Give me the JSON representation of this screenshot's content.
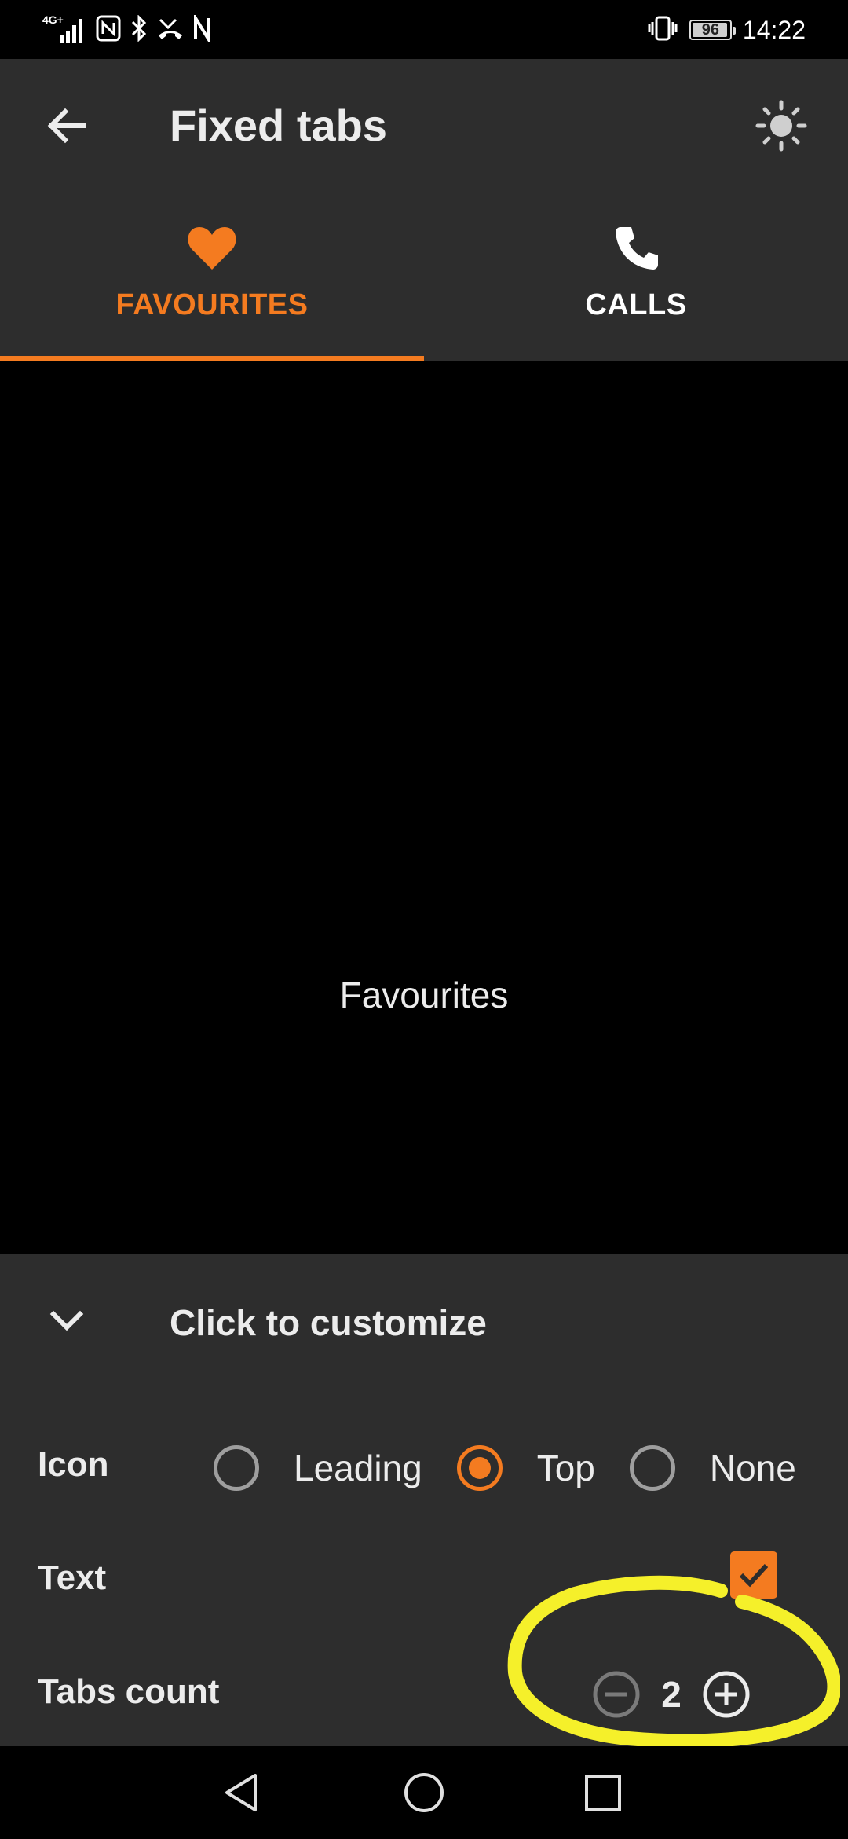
{
  "status_bar": {
    "network": "4G+",
    "battery": "96",
    "battery_level": 0.96,
    "time": "14:22"
  },
  "app_bar": {
    "title": "Fixed tabs",
    "back_icon": "arrow-back-icon",
    "theme_icon": "sun-icon"
  },
  "tabs": [
    {
      "label": "FAVOURITES",
      "icon": "heart-icon",
      "selected": true
    },
    {
      "label": "CALLS",
      "icon": "phone-icon",
      "selected": false
    }
  ],
  "content": {
    "text": "Favourites"
  },
  "panel": {
    "title": "Click to customize",
    "icon_row": {
      "label": "Icon",
      "options": [
        "Leading",
        "Top",
        "None"
      ],
      "selected": "Top"
    },
    "text_row": {
      "label": "Text",
      "checked": true
    },
    "tabs_count_row": {
      "label": "Tabs count",
      "value": "2"
    }
  },
  "colors": {
    "accent": "#f47b20",
    "surface": "#2d2d2d",
    "background": "#000000",
    "annotation": "#f5f02a"
  }
}
